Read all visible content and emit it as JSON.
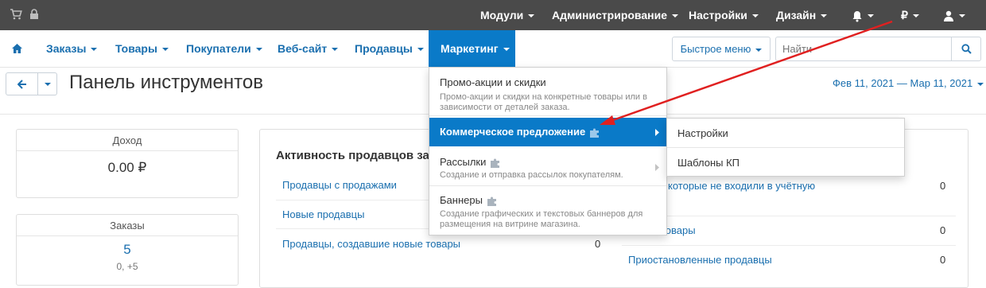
{
  "topbar": {
    "menu": [
      {
        "label": "Модули"
      },
      {
        "label": "Администрирование"
      },
      {
        "label": "Настройки"
      },
      {
        "label": "Дизайн"
      }
    ],
    "currency": "₽"
  },
  "nav": {
    "items": [
      {
        "label": "Заказы"
      },
      {
        "label": "Товары"
      },
      {
        "label": "Покупатели"
      },
      {
        "label": "Веб-сайт"
      },
      {
        "label": "Продавцы"
      },
      {
        "label": "Маркетинг"
      }
    ],
    "quick_menu": "Быстрое меню",
    "search_placeholder": "Найти"
  },
  "header": {
    "title": "Панель инструментов",
    "date_range": "Фев 11, 2021 — Мар 11, 2021"
  },
  "cards": {
    "income": {
      "label": "Доход",
      "value": "0.00 ₽"
    },
    "orders": {
      "label": "Заказы",
      "value": "5",
      "sub": "0, +5"
    }
  },
  "activity": {
    "title": "Активность продавцов за",
    "left_rows": [
      {
        "label": "Продавцы с продажами"
      },
      {
        "label": "Новые продавцы"
      },
      {
        "label": "Продавцы, создавшие новые товары",
        "value": "0"
      }
    ],
    "right_rows": [
      {
        "label": "цы, которые не входили в учётную",
        "value": "0"
      },
      {
        "label": "товары",
        "value": "0"
      },
      {
        "label": "Приостановленные продавцы",
        "value": "0"
      }
    ]
  },
  "marketing_menu": {
    "items": [
      {
        "title": "Промо-акции и скидки",
        "desc": "Промо-акции и скидки на конкретные товары или в зависимости от деталей заказа."
      },
      {
        "title": "Коммерческое предложение"
      },
      {
        "title": "Рассылки",
        "desc": "Создание и отправка рассылок покупателям."
      },
      {
        "title": "Баннеры",
        "desc": "Создание графических и текстовых баннеров для размещения на витрине магазина."
      }
    ],
    "submenu": [
      {
        "label": "Настройки"
      },
      {
        "label": "Шаблоны КП"
      }
    ]
  },
  "colors": {
    "accent": "#0a7ac8",
    "link": "#1a6faf",
    "topbar": "#4a4a4a",
    "arrow": "#e02020"
  }
}
